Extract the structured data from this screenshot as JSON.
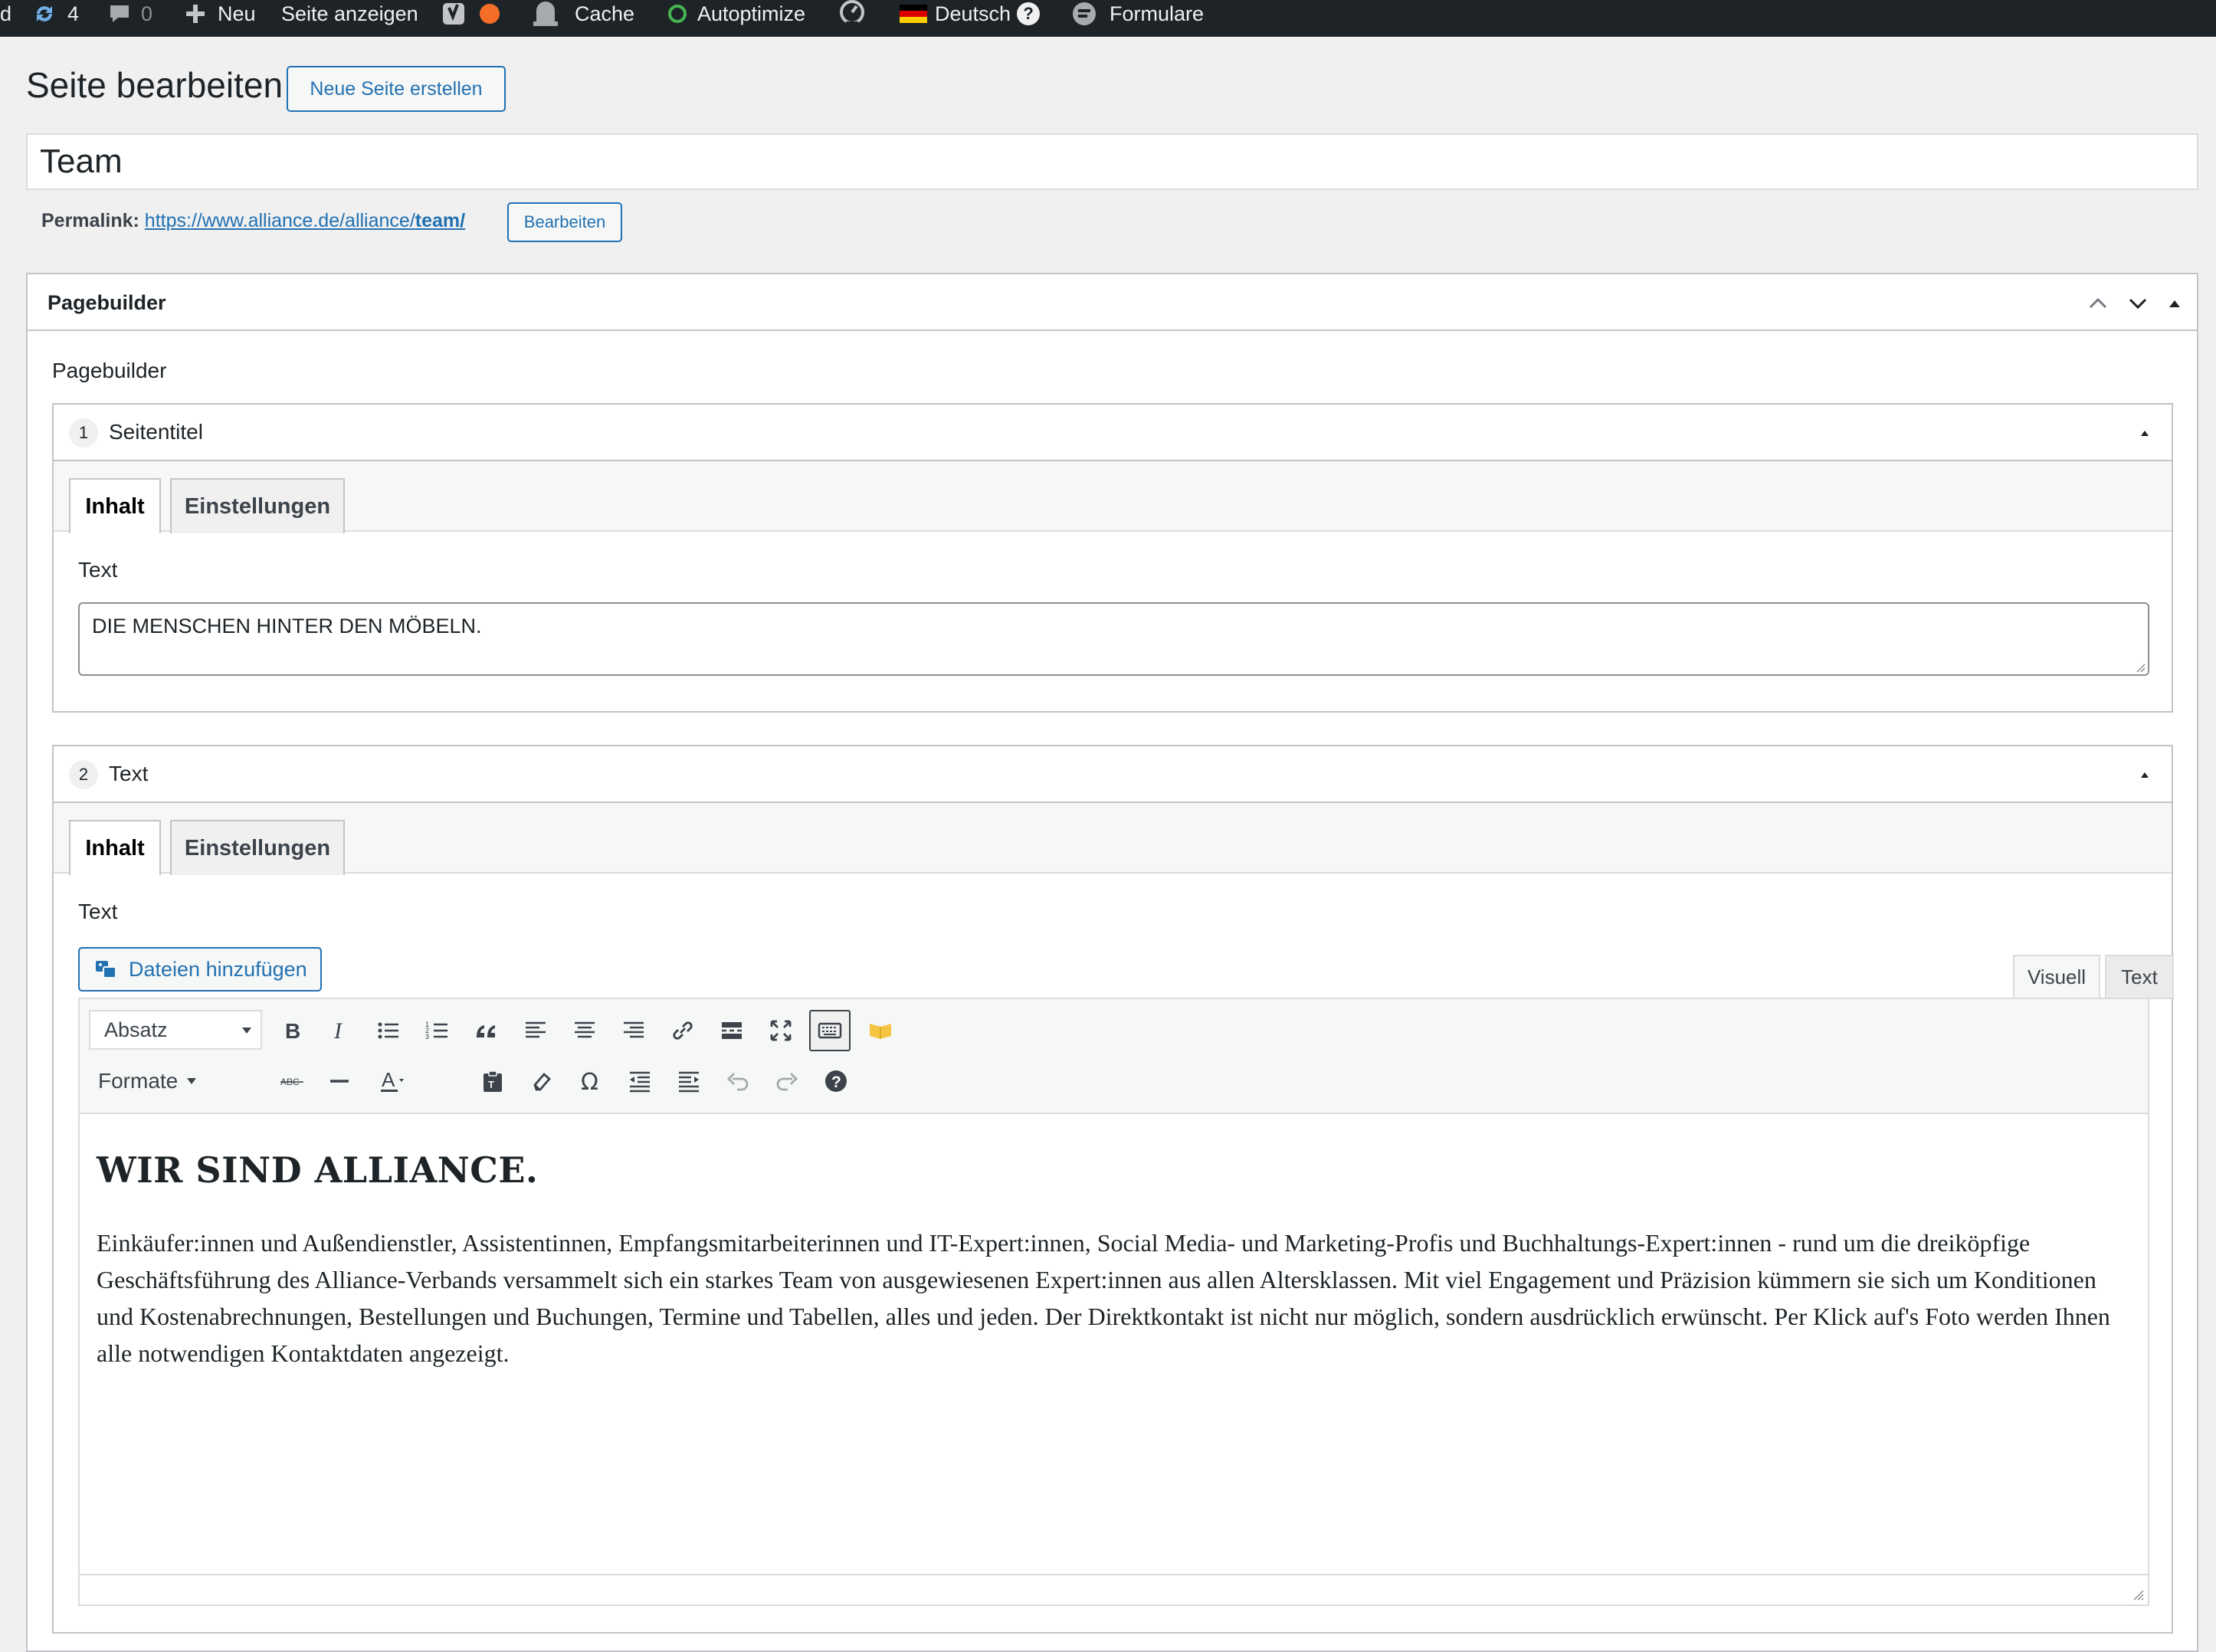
{
  "admin_bar": {
    "left_fragment": "d",
    "updates_count": "4",
    "comments_count": "0",
    "new_label": "Neu",
    "view_page_label": "Seite anzeigen",
    "cache_label": "Cache",
    "autoptimize_label": "Autoptimize",
    "language_label": "Deutsch",
    "forms_label": "Formulare",
    "colors": {
      "bar_bg": "#1d2327",
      "status_orange": "#f56e28",
      "status_green": "#46b450"
    }
  },
  "header": {
    "title": "Seite bearbeiten",
    "new_page_button": "Neue Seite erstellen"
  },
  "post": {
    "title_value": "Team",
    "permalink_label": "Permalink:",
    "permalink_base": "https://www.alliance.de/alliance/",
    "permalink_slug": "team/",
    "permalink_edit_button": "Bearbeiten"
  },
  "postbox": {
    "title": "Pagebuilder",
    "field_label": "Pagebuilder",
    "layouts": [
      {
        "number": "1",
        "title": "Seitentitel",
        "tabs": [
          "Inhalt",
          "Einstellungen"
        ],
        "field_label": "Text",
        "text_value": "DIE MENSCHEN HINTER DEN MÖBELN."
      },
      {
        "number": "2",
        "title": "Text",
        "tabs": [
          "Inhalt",
          "Einstellungen"
        ],
        "field_label": "Text",
        "add_media_button": "Dateien hinzufügen",
        "editor_modes": [
          "Visuell",
          "Text"
        ],
        "format_select_value": "Absatz",
        "formats_menu": "Formate",
        "content_heading": "WIR SIND ALLIANCE.",
        "content_paragraph": "Einkäufer:innen und Außendienstler, Assistentinnen, Empfangsmitarbeiterinnen und IT-Expert:innen, Social Media- und Marketing-Profis und Buchhaltungs-Expert:innen - rund um die dreiköpfige Geschäftsführung des Alliance-Verbands versammelt sich ein starkes Team von ausgewiesenen Expert:innen aus allen Altersklassen. Mit viel Engagement und Präzision kümmern sie sich um Konditionen und Kostenabrechnungen, Bestellungen und Buchungen, Termine und Tabellen, alles und jeden. Der Direktkontakt ist nicht nur möglich, sondern ausdrücklich erwünscht. Per Klick auf's Foto werden Ihnen alle notwendigen Kontaktdaten angezeigt."
      }
    ]
  },
  "toolbar_icons": {
    "row1": [
      "bold-icon",
      "italic-icon",
      "bullet-list-icon",
      "numbered-list-icon",
      "blockquote-icon",
      "align-left-icon",
      "align-center-icon",
      "align-right-icon",
      "link-icon",
      "read-more-icon",
      "fullscreen-icon",
      "toolbar-toggle-icon",
      "flipbook-icon"
    ],
    "row2": [
      "strikethrough-icon",
      "horizontal-line-icon",
      "text-color-icon",
      "paste-text-icon",
      "clear-formatting-icon",
      "special-character-icon",
      "outdent-icon",
      "indent-icon",
      "undo-icon",
      "redo-icon",
      "help-icon"
    ]
  },
  "accent_color": "#2271b1"
}
